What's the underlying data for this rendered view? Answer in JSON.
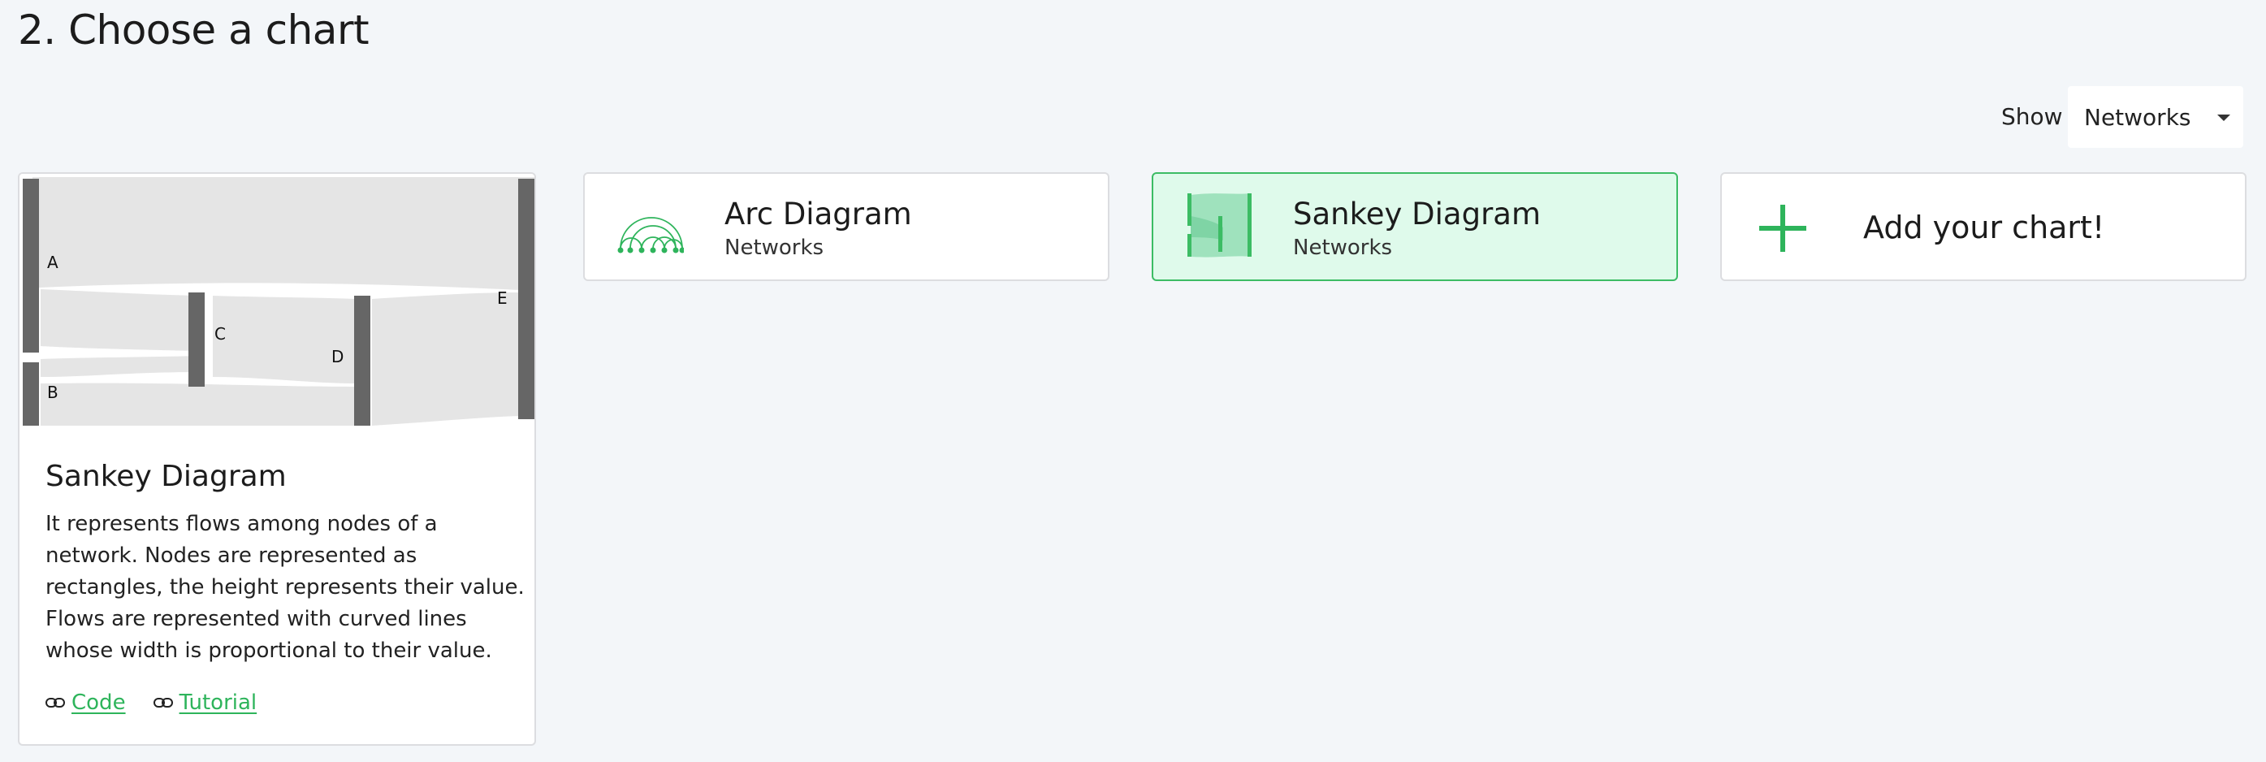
{
  "page": {
    "title": "2. Choose a chart"
  },
  "filter": {
    "label": "Show",
    "selected": "Networks"
  },
  "detail": {
    "title": "Sankey Diagram",
    "description": "It represents flows among nodes of a network. Nodes are represented as rectangles, the height represents their value. Flows are represented with curved lines whose width is proportional to their value.",
    "preview_nodes": [
      "A",
      "B",
      "C",
      "D",
      "E"
    ],
    "links": [
      {
        "label": "Code",
        "icon": "link-icon"
      },
      {
        "label": "Tutorial",
        "icon": "link-icon"
      }
    ]
  },
  "charts": [
    {
      "name": "Arc Diagram",
      "category": "Networks",
      "icon": "arc-diagram-icon",
      "selected": false
    },
    {
      "name": "Sankey Diagram",
      "category": "Networks",
      "icon": "sankey-diagram-icon",
      "selected": true
    }
  ],
  "add_chart": {
    "label": "Add your chart!",
    "icon": "plus-icon"
  },
  "colors": {
    "accent": "#2eb45b",
    "selected_bg": "#dffaeb",
    "node": "#666666",
    "flow": "#e5e5e5",
    "background": "#f3f6f9"
  }
}
